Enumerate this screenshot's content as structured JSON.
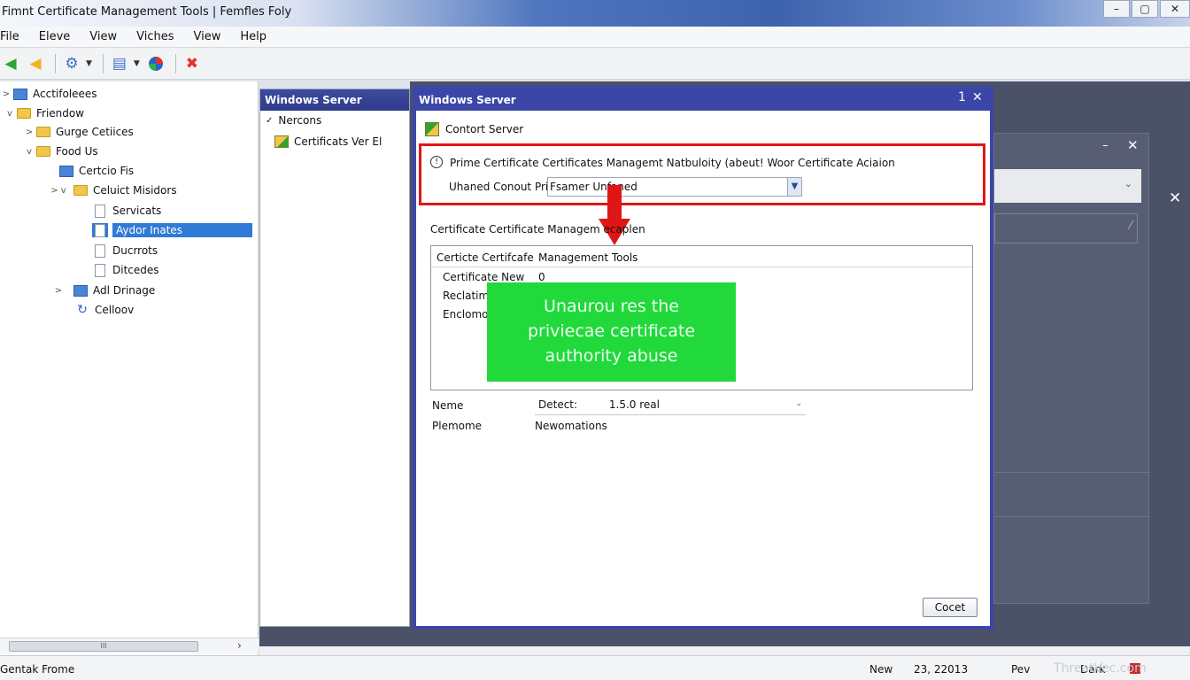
{
  "window": {
    "title": "Fimnt Certificate Management Tools | Femfles Foly",
    "controls": [
      "–",
      "▢",
      "✕"
    ]
  },
  "menubar": [
    "File",
    "Eleve",
    "View",
    "Viches",
    "View",
    "Help"
  ],
  "tree": {
    "nodes": [
      {
        "label": "Acctifoleees",
        "exp": ">"
      },
      {
        "label": "Friendow",
        "exp": "v"
      },
      {
        "label": "Gurge Cetiices",
        "exp": ">"
      },
      {
        "label": "Food Us",
        "exp": "v"
      },
      {
        "label": "Certcio Fis",
        "exp": ""
      },
      {
        "label": "Celuict Misidors",
        "exp": "> v"
      },
      {
        "label": "Servicats",
        "exp": ""
      },
      {
        "label": "Aydor Inates",
        "exp": "",
        "selected": true
      },
      {
        "label": "Ducrrots",
        "exp": ""
      },
      {
        "label": "Ditcedes",
        "exp": ""
      },
      {
        "label": "Adl Drinage",
        "exp": ">"
      },
      {
        "label": "Celloov",
        "exp": ""
      }
    ],
    "scroll_thumb": "III"
  },
  "middle_pane": {
    "header": "Windows Server",
    "items": [
      {
        "label": "Nercons",
        "mark": "✓"
      },
      {
        "label": "Certificats Ver El",
        "mark": ""
      }
    ]
  },
  "dialog": {
    "title": "Windows Server",
    "controls": [
      "1",
      "✕"
    ],
    "section_label": "Contort Server",
    "notice_text": "Prime  Certificate Certificates Managemt Natbuloity (abeut! Woor Certificate Aciaion",
    "field_label": "Uhaned Conout Privice",
    "combo_value": "Fsamer    Unfaned",
    "subheading": "Certificate Certificate  Managem   ecaplen",
    "table": {
      "col1_header": "Certicte Certifcafe",
      "col2_header": "Management Tools",
      "rows": [
        {
          "label": "Certificate New",
          "value": "0"
        },
        {
          "label": "Reclatim",
          "value": ""
        },
        {
          "label": "Enclomo",
          "value": ""
        }
      ]
    },
    "overlay_text": [
      "Unaurou res the",
      "priviecae certificate",
      "authority abuse"
    ],
    "name_label": "Neme",
    "name_combo": {
      "label": "Detect:",
      "value": "1.5.0 real"
    },
    "phone_label": "Plemome",
    "phone_value": "Newomations",
    "cancel_button": "Cocet"
  },
  "statusbar": {
    "left": "Gentak Frome",
    "new": "New",
    "date": "23, 22013",
    "rev": "Pev",
    "dark": "Dark",
    "watermark": "ThreatVec.com"
  },
  "colors": {
    "dialog_frame": "#3c46a8",
    "highlight_red": "#e01616",
    "overlay_green": "#21d93a",
    "selection_blue": "#2f7bd6"
  }
}
